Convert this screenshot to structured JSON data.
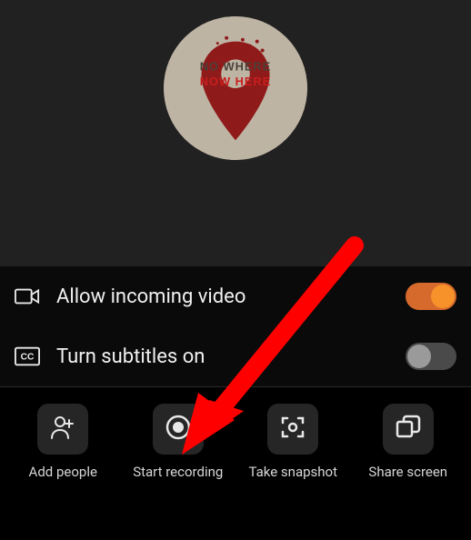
{
  "avatar": {
    "line1": "NO WHERE",
    "line2": "NOW HERE"
  },
  "options": {
    "allow_incoming_video": {
      "label": "Allow incoming video",
      "on": true
    },
    "turn_subtitles_on": {
      "label": "Turn subtitles on",
      "on": false
    }
  },
  "actions": {
    "add_people": "Add people",
    "start_recording": "Start recording",
    "take_snapshot": "Take snapshot",
    "share_screen": "Share screen"
  },
  "annotation": {
    "target": "start_recording"
  }
}
